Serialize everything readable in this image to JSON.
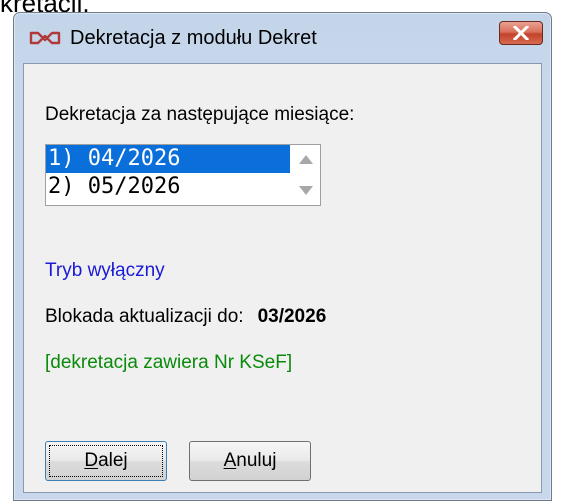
{
  "background_fragment": "kretacji.",
  "dialog": {
    "title": "Dekretacja z modułu Dekret",
    "icon": "link-chain-icon",
    "close_label": "close"
  },
  "months": {
    "label": "Dekretacja za następujące miesiące:",
    "items": [
      "1) 04/2026",
      "2) 05/2026"
    ],
    "selected_index": 0
  },
  "mode": {
    "text": "Tryb wyłączny"
  },
  "lock": {
    "label": "Blokada aktualizacji do:",
    "value": "03/2026"
  },
  "ksef": {
    "text": "[dekretacja zawiera Nr KSeF]"
  },
  "buttons": {
    "next_accel": "D",
    "next_rest": "alej",
    "cancel_accel": "A",
    "cancel_rest": "nuluj"
  },
  "colors": {
    "selection": "#0a6fdb",
    "mode_text": "#1a1ad6",
    "ksef_text": "#0a8a0a",
    "close_button": "#c2432b"
  }
}
